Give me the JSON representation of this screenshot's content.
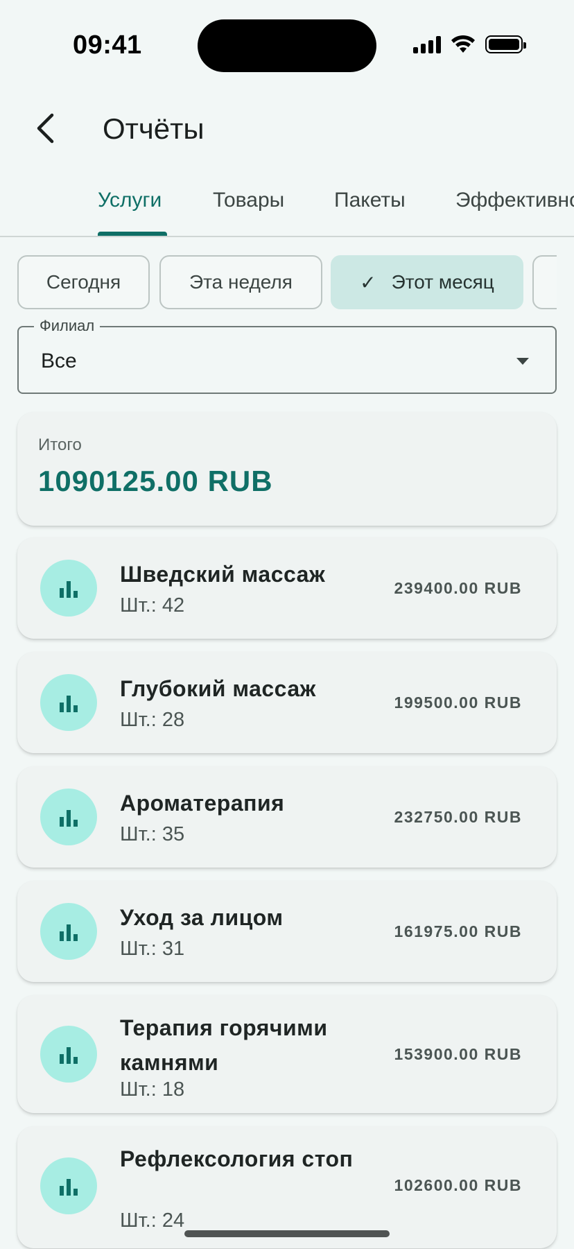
{
  "status_bar": {
    "time": "09:41"
  },
  "app_bar": {
    "title": "Отчёты"
  },
  "tabs": [
    {
      "label": "Услуги",
      "active": true
    },
    {
      "label": "Товары",
      "active": false
    },
    {
      "label": "Пакеты",
      "active": false
    },
    {
      "label": "Эффективно",
      "active": false
    }
  ],
  "filters": [
    {
      "label": "Сегодня",
      "selected": false
    },
    {
      "label": "Эта неделя",
      "selected": false
    },
    {
      "label": "Этот месяц",
      "selected": true
    }
  ],
  "branch_select": {
    "label": "Филиал",
    "value": "Все"
  },
  "total": {
    "label": "Итого",
    "value": "1090125.00 RUB"
  },
  "services": [
    {
      "name": "Шведский массаж",
      "qty": "Шт.: 42",
      "amount": "239400.00 RUB",
      "icon": "bar-chart-icon"
    },
    {
      "name": "Глубокий массаж",
      "qty": "Шт.: 28",
      "amount": "199500.00 RUB",
      "icon": "bar-chart-icon"
    },
    {
      "name": "Ароматерапия",
      "qty": "Шт.: 35",
      "amount": "232750.00 RUB",
      "icon": "bar-chart-icon"
    },
    {
      "name": "Уход за лицом",
      "qty": "Шт.: 31",
      "amount": "161975.00 RUB",
      "icon": "bar-chart-icon"
    },
    {
      "name": "Терапия горячими камнями",
      "qty": "Шт.: 18",
      "amount": "153900.00 RUB",
      "icon": "bar-chart-icon"
    },
    {
      "name": "Рефлексология стоп",
      "qty": "Шт.: 24",
      "amount": "102600.00 RUB",
      "icon": "bar-chart-icon"
    }
  ],
  "colors": {
    "accent": "#0f6f66",
    "icon_bg": "#a7ede3",
    "chip_selected": "#cce8e4",
    "background": "#f2f7f6"
  }
}
